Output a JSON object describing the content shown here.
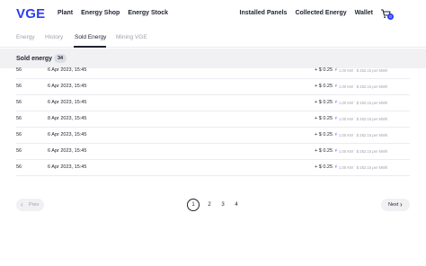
{
  "brand": {
    "logo": "VGE",
    "accent": "#2d3cf5"
  },
  "nav": {
    "left": [
      "Plant",
      "Energy Shop",
      "Energy Stock"
    ],
    "right": [
      "Installed Panels",
      "Collected Energy",
      "Wallet"
    ],
    "cart_icon": "cart-icon",
    "cart_count": "0"
  },
  "tabs": [
    {
      "label": "Energy",
      "active": false
    },
    {
      "label": "History",
      "active": false
    },
    {
      "label": "Sold Energy",
      "active": true
    },
    {
      "label": "Mining VGE",
      "active": false
    }
  ],
  "section": {
    "title": "Sold energy",
    "count": "34"
  },
  "rows": [
    {
      "id": "56",
      "date": "6 Apr 2023, 15:45",
      "amount": "+ $ 0.25",
      "rate": "1.00 KW ˙ $ 252.15 per MWh"
    },
    {
      "id": "56",
      "date": "6 Apr 2023, 15:45",
      "amount": "+ $ 0.25",
      "rate": "1.00 KW ˙ $ 252.15 per MWh"
    },
    {
      "id": "56",
      "date": "6 Apr 2023, 15:45",
      "amount": "+ $ 0.25",
      "rate": "1.00 KW ˙ $ 252.15 per MWh"
    },
    {
      "id": "56",
      "date": "8 Apr 2023, 15:45",
      "amount": "+ $ 0.25",
      "rate": "1.00 KW ˙ $ 252.15 per MWh"
    },
    {
      "id": "56",
      "date": "6 Apr 2023, 15:45",
      "amount": "+ $ 0.25",
      "rate": "1.00 KW ˙ $ 252.15 per MWh"
    },
    {
      "id": "56",
      "date": "6 Apr 2023, 15:45",
      "amount": "+ $ 0.25",
      "rate": "1.00 KW ˙ $ 252.15 per MWh"
    },
    {
      "id": "56",
      "date": "6 Apr 2023, 15:45",
      "amount": "+ $ 0.25",
      "rate": "1.00 KW ˙ $ 252.15 per MWh"
    }
  ],
  "pagination": {
    "prev_label": "Prev",
    "next_label": "Next",
    "pages": [
      "1",
      "2",
      "3",
      "4"
    ],
    "current": "1"
  }
}
